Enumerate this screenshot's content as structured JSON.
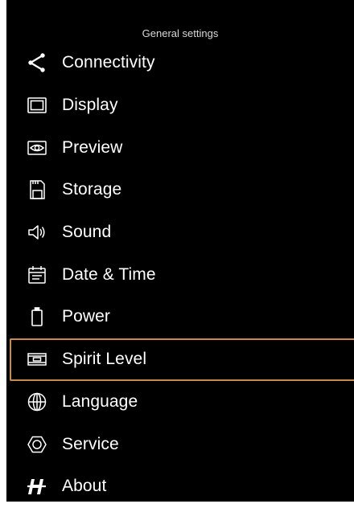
{
  "header": {
    "title": "General settings"
  },
  "menu": {
    "selected_index": 8,
    "items": [
      {
        "label": "Connectivity",
        "icon": "share-icon"
      },
      {
        "label": "Display",
        "icon": "display-icon"
      },
      {
        "label": "Preview",
        "icon": "eye-icon"
      },
      {
        "label": "Storage",
        "icon": "sd-card-icon"
      },
      {
        "label": "Sound",
        "icon": "speaker-icon"
      },
      {
        "label": "Date & Time",
        "icon": "calendar-icon"
      },
      {
        "label": "Power",
        "icon": "battery-icon"
      },
      {
        "label": "Spirit Level",
        "icon": "spirit-level-icon"
      },
      {
        "label": "Language",
        "icon": "globe-icon"
      },
      {
        "label": "Service",
        "icon": "hexagon-icon"
      },
      {
        "label": "About",
        "icon": "h-logo-icon"
      }
    ]
  },
  "colors": {
    "background": "#000000",
    "text": "#ffffff",
    "selection_border": "#c98a4e"
  }
}
